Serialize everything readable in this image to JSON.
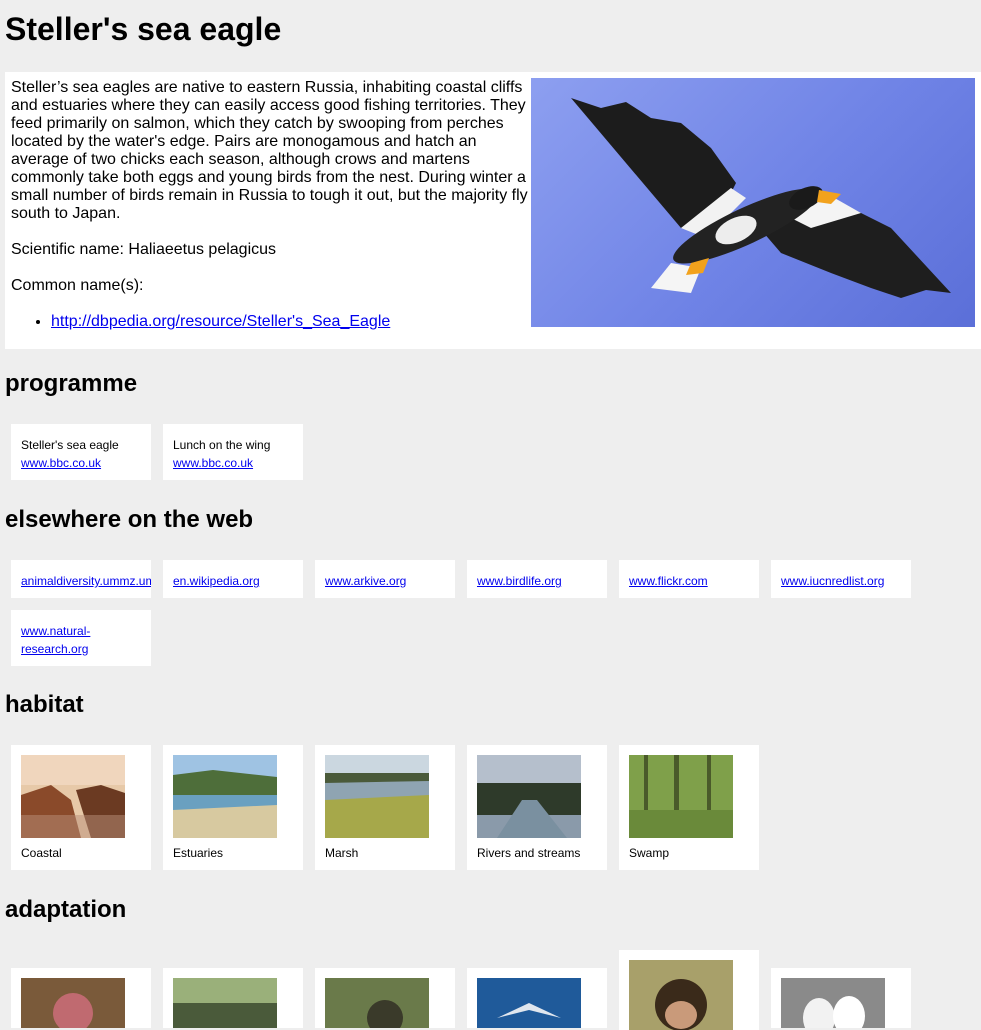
{
  "page": {
    "title": "Steller's sea eagle"
  },
  "intro": {
    "description": "Steller’s sea eagles are native to eastern Russia, inhabiting coastal cliffs and estuaries where they can easily access good fishing territories. They feed primarily on salmon, which they catch by swooping from perches located by the water's edge. Pairs are monogamous and hatch an average of two chicks each season, although crows and martens commonly take both eggs and young birds from the nest. During winter a small number of birds remain in Russia to tough it out, but the majority fly south to Japan.",
    "scientific_name": "Scientific name: Haliaeetus pelagicus",
    "common_names_label": "Common name(s):",
    "common_name_link": "http://dbpedia.org/resource/Steller's_Sea_Eagle"
  },
  "programme": {
    "heading": "programme",
    "items": [
      {
        "title": "Steller's sea eagle",
        "link": "www.bbc.co.uk"
      },
      {
        "title": "Lunch on the wing",
        "link": "www.bbc.co.uk"
      }
    ]
  },
  "elsewhere": {
    "heading": "elsewhere on the web",
    "links": [
      "animaldiversity.ummz.umich.edu",
      "en.wikipedia.org",
      "www.arkive.org",
      "www.birdlife.org",
      "www.flickr.com",
      "www.iucnredlist.org",
      "www.natural-research.org"
    ]
  },
  "habitat": {
    "heading": "habitat",
    "items": [
      {
        "label": "Coastal"
      },
      {
        "label": "Estuaries"
      },
      {
        "label": "Marsh"
      },
      {
        "label": "Rivers and streams"
      },
      {
        "label": "Swamp"
      }
    ]
  },
  "adaptation": {
    "heading": "adaptation"
  }
}
